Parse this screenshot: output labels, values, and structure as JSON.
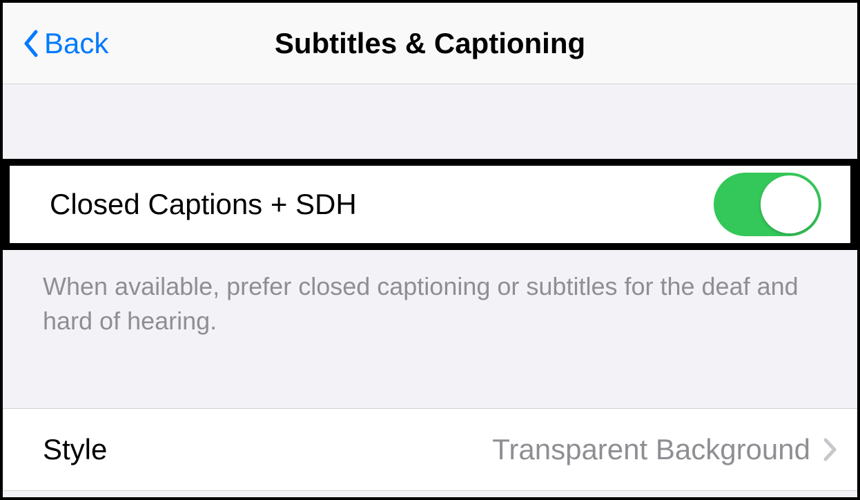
{
  "nav": {
    "back_label": "Back",
    "title": "Subtitles & Captioning"
  },
  "rows": {
    "cc_sdh": {
      "label": "Closed Captions + SDH",
      "toggle_on": true
    },
    "footer": "When available, prefer closed captioning or subtitles for the deaf and hard of hearing.",
    "style": {
      "label": "Style",
      "value": "Transparent Background"
    }
  },
  "colors": {
    "accent": "#007aff",
    "toggle_on": "#34c759"
  }
}
